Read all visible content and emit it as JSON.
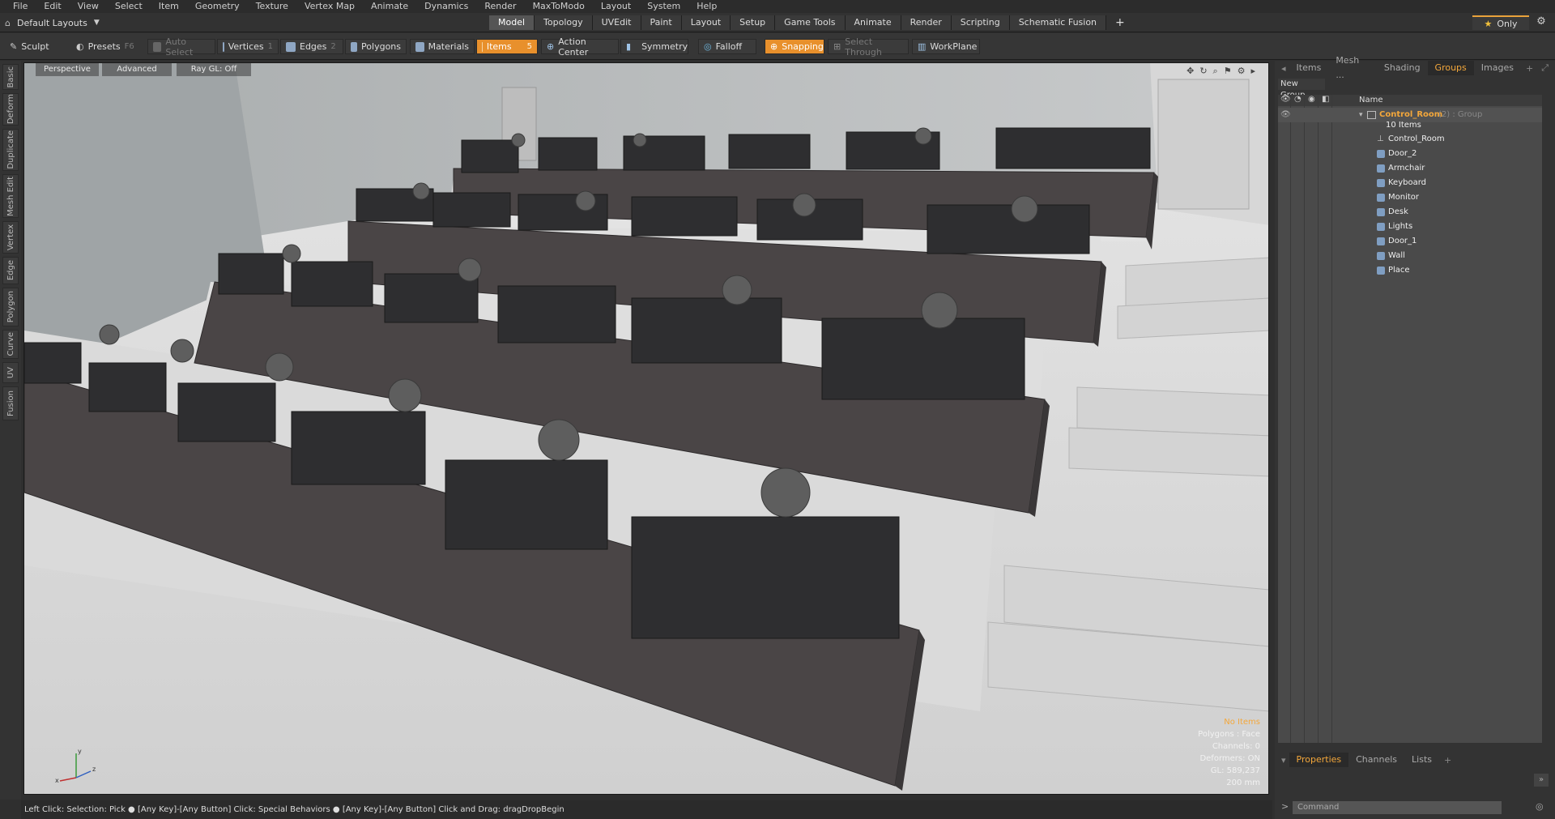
{
  "menu": [
    "File",
    "Edit",
    "View",
    "Select",
    "Item",
    "Geometry",
    "Texture",
    "Vertex Map",
    "Animate",
    "Dynamics",
    "Render",
    "MaxToModo",
    "Layout",
    "System",
    "Help"
  ],
  "layout_dropdown": "Default Layouts",
  "layout_tabs": [
    "Model",
    "Topology",
    "UVEdit",
    "Paint",
    "Layout",
    "Setup",
    "Game Tools",
    "Animate",
    "Render",
    "Scripting",
    "Schematic Fusion"
  ],
  "active_layout_tab": "Model",
  "only_label": "Only",
  "toolbar": {
    "sculpt": "Sculpt",
    "presets": "Presets",
    "presets_key": "F6",
    "auto_select": "Auto Select",
    "vertices": "Vertices",
    "vertices_key": "1",
    "edges": "Edges",
    "edges_key": "2",
    "polygons": "Polygons",
    "materials": "Materials",
    "items": "Items",
    "items_key": "5",
    "action_center": "Action Center",
    "symmetry": "Symmetry",
    "falloff": "Falloff",
    "snapping": "Snapping",
    "select_through": "Select Through",
    "workplane": "WorkPlane"
  },
  "left_tabs": [
    "Basic",
    "Deform",
    "Duplicate",
    "Mesh Edit",
    "Vertex",
    "Edge",
    "Polygon",
    "Curve",
    "UV",
    "Fusion"
  ],
  "viewport": {
    "view": "Perspective",
    "mode": "Advanced",
    "raygl": "Ray GL: Off",
    "info": [
      "No Items",
      "Polygons : Face",
      "Channels: 0",
      "Deformers: ON",
      "GL: 589,237",
      "200 mm"
    ]
  },
  "status": "Left Click: Selection: Pick ● [Any Key]-[Any Button] Click: Special Behaviors ● [Any Key]-[Any Button] Click and Drag: dragDropBegin",
  "right_panel": {
    "tabs": [
      "Items",
      "Mesh ...",
      "Shading",
      "Groups",
      "Images"
    ],
    "active_tab": "Groups",
    "new_group": "New Group",
    "name_col": "Name",
    "group_name": "Control_Room",
    "group_suffix": "(2) : Group",
    "item_count": "10 Items",
    "children": [
      "Control_Room",
      "Door_2",
      "Armchair",
      "Keyboard",
      "Monitor",
      "Desk",
      "Lights",
      "Door_1",
      "Wall",
      "Place"
    ],
    "bottom_tabs": [
      "Properties",
      "Channels",
      "Lists"
    ],
    "command_placeholder": "Command"
  },
  "colors": {
    "accent": "#e8902c",
    "selected_text": "#f3a73b"
  }
}
